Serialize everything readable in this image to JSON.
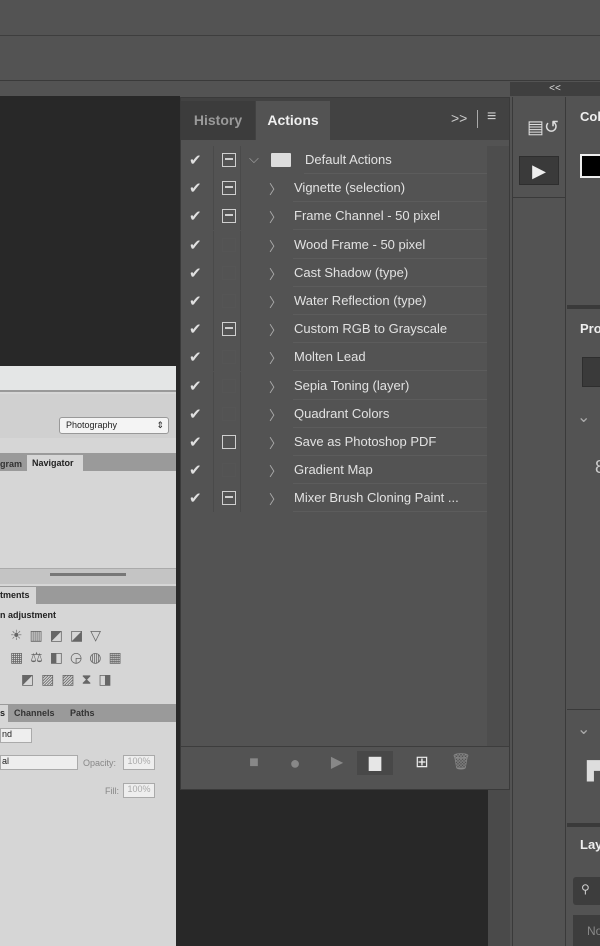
{
  "collapse_label": "<<",
  "panel": {
    "tabs": [
      "History",
      "Actions"
    ],
    "expand_icon": ">>",
    "menu_icon": "menu-icon",
    "rows": [
      {
        "label": "Default Actions",
        "toggle": "dash",
        "type": "set"
      },
      {
        "label": "Vignette (selection)",
        "toggle": "dash"
      },
      {
        "label": "Frame Channel - 50 pixel",
        "toggle": "dash"
      },
      {
        "label": "Wood Frame - 50 pixel",
        "toggle": "none"
      },
      {
        "label": "Cast Shadow (type)",
        "toggle": "none"
      },
      {
        "label": "Water Reflection (type)",
        "toggle": "none"
      },
      {
        "label": "Custom RGB to Grayscale",
        "toggle": "dash"
      },
      {
        "label": "Molten Lead",
        "toggle": "none"
      },
      {
        "label": "Sepia Toning (layer)",
        "toggle": "none"
      },
      {
        "label": "Quadrant Colors",
        "toggle": "none"
      },
      {
        "label": "Save as Photoshop PDF",
        "toggle": "box"
      },
      {
        "label": "Gradient Map",
        "toggle": "none"
      },
      {
        "label": "Mixer Brush Cloning Paint ...",
        "toggle": "dash"
      }
    ],
    "footer": [
      "stop",
      "record",
      "play",
      "new-set",
      "new-action",
      "delete"
    ]
  },
  "right": {
    "color": "Col",
    "properties": "Pro",
    "layers": "Lay",
    "kind": "No"
  },
  "shot": {
    "workspace": "Photography",
    "tab1": "gram",
    "tab2": "Navigator",
    "adj_tab": "tments",
    "adj_title": "n adjustment",
    "tab3": "s",
    "tab4": "Channels",
    "tab5": "Paths",
    "kind": "nd",
    "blend": "al",
    "opacity_label": "Opacity:",
    "opacity": "100%",
    "fill_label": "Fill:",
    "fill": "100%"
  }
}
